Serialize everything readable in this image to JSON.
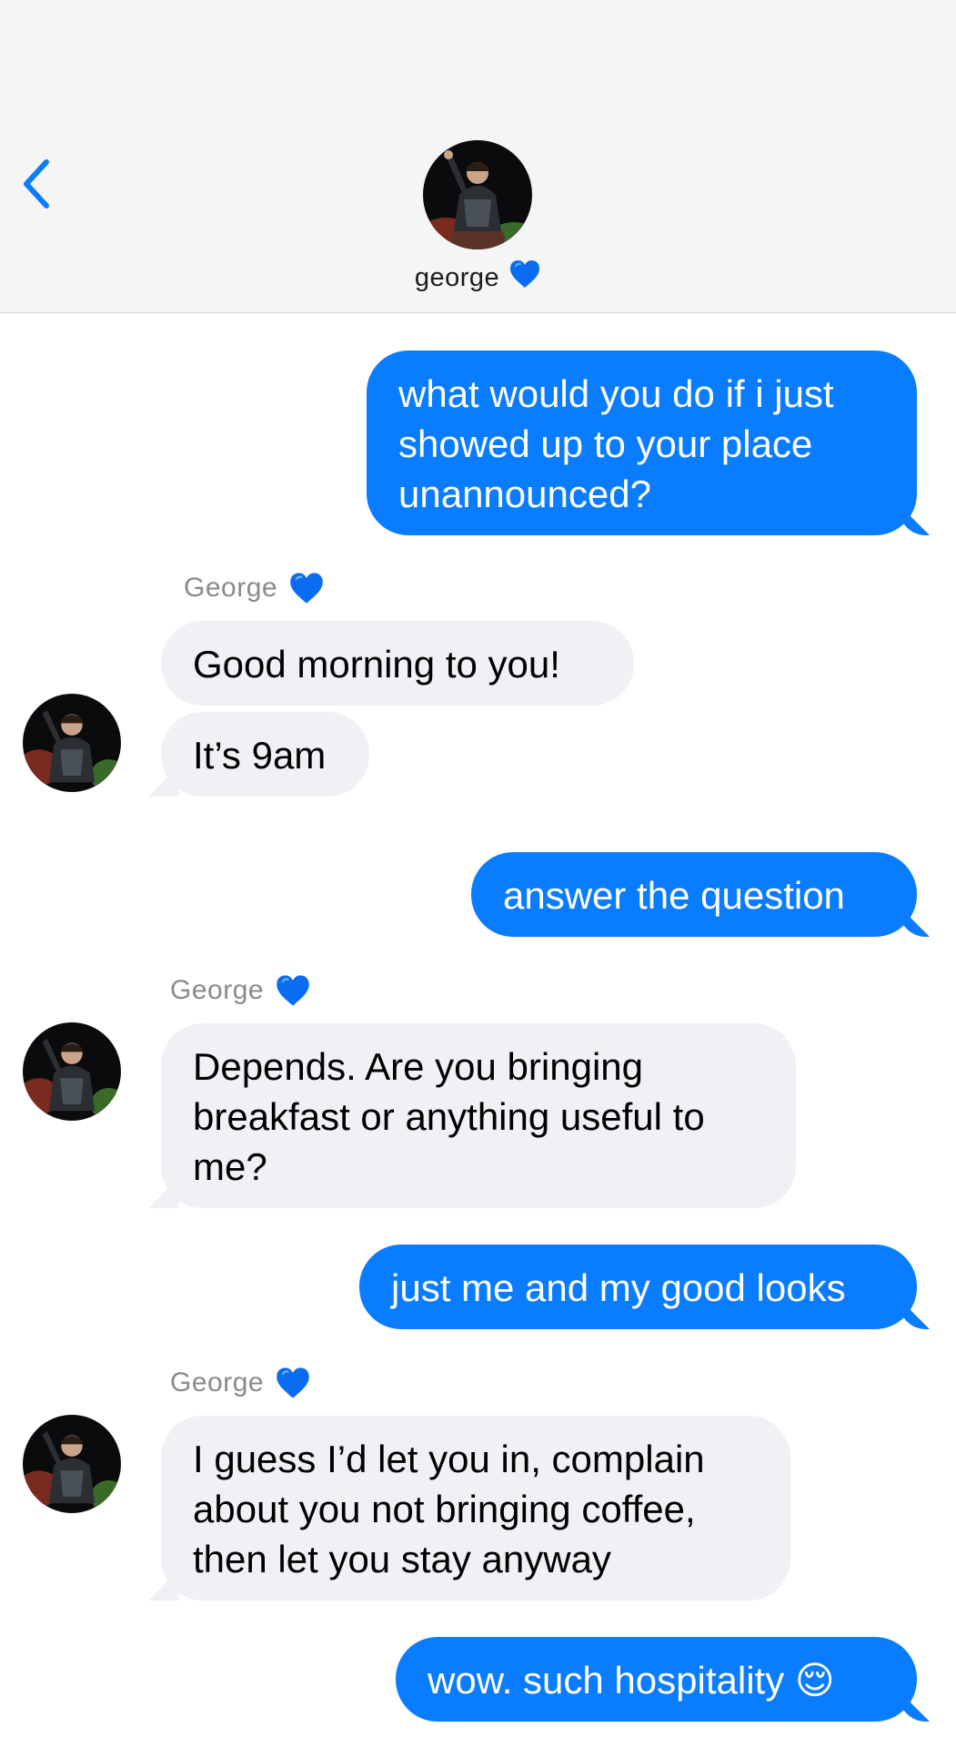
{
  "header": {
    "contact_name": "george",
    "contact_emoji": "💙"
  },
  "messages": [
    {
      "from": "me",
      "text": "what would you do if i just showed up to your place unannounced?"
    },
    {
      "from": "george",
      "sender_label": "George",
      "sender_emoji": "💙",
      "text": "Good morning to you!"
    },
    {
      "from": "george",
      "text": "It’s 9am"
    },
    {
      "from": "me",
      "text": "answer the question"
    },
    {
      "from": "george",
      "sender_label": "George",
      "sender_emoji": "💙",
      "text": "Depends. Are you bringing breakfast or anything useful to me?"
    },
    {
      "from": "me",
      "text": "just me and my good looks"
    },
    {
      "from": "george",
      "sender_label": "George",
      "sender_emoji": "💙",
      "text": "I guess I’d let you in, complain about you not bringing coffee, then let you stay anyway"
    },
    {
      "from": "me",
      "text": "wow. such hospitality 😌"
    }
  ],
  "colors": {
    "sent_bubble": "#0a7cff",
    "received_bubble": "#f0f0f5",
    "back_chevron": "#0a7cff"
  }
}
